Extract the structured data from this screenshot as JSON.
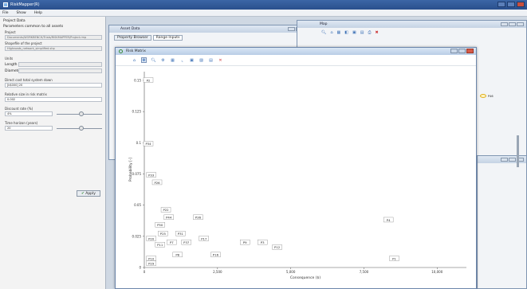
{
  "app": {
    "title": "RiskMapper(R)"
  },
  "menu": [
    "File",
    "Show",
    "Help"
  ],
  "left": {
    "section_title": "Project Data",
    "subsection": "Parameters common to all assets",
    "project_label": "Project",
    "project_value": "Documents/WORKBENCH/Trials/RISKMAPPER/Project.rmp",
    "shapefile_label": "Shapefile of the project",
    "shapefile_value": "Highroads_network_simplified.shp",
    "units_label": "Units",
    "length_label": "Length",
    "diameter_label": "Diameter",
    "direct_cost_label": "Direct cost total system down",
    "direct_cost_value": "[k$000] 20",
    "relative_size_label": "Relative size in risk matrix",
    "relative_size_value": "0.002",
    "discount_label": "Discount rate (%)",
    "discount_value": "4%",
    "discount_level": 0.55,
    "time_label": "Time horizon (years)",
    "time_value": "20",
    "time_level": 0.55,
    "apply_label": "Apply"
  },
  "asset_window": {
    "title": "Asset Data",
    "tabs": [
      "Property Browser",
      "Range Inputs"
    ]
  },
  "map_window": {
    "title": "Map",
    "marker_label": "P46"
  },
  "risk_window": {
    "title": "Risk Matrix"
  },
  "chart_data": {
    "type": "scatter",
    "title": "",
    "xlabel": "Consequence ($)",
    "ylabel": "Probability [-]",
    "xlim": [
      0,
      11000
    ],
    "ylim": [
      0,
      0.157
    ],
    "x_ticks": [
      "0",
      "2,500",
      "5,000",
      "7,500",
      "10,000",
      "12,500"
    ],
    "x_tick_values": [
      0,
      2500,
      5000,
      7500,
      10000,
      12500
    ],
    "y_ticks": [
      "0",
      "0.025",
      "0.05",
      "0.075",
      "0.1",
      "0.125",
      "0.15"
    ],
    "y_tick_values": [
      0,
      0.025,
      0.05,
      0.075,
      0.1,
      0.125,
      0.15
    ],
    "points": [
      {
        "label": "P2",
        "x": 0,
        "y": 0.15
      },
      {
        "label": "P34",
        "x": 0,
        "y": 0.099
      },
      {
        "label": "P33",
        "x": 100,
        "y": 0.074
      },
      {
        "label": "P26",
        "x": 300,
        "y": 0.068
      },
      {
        "label": "P22",
        "x": 600,
        "y": 0.046
      },
      {
        "label": "P44",
        "x": 700,
        "y": 0.04
      },
      {
        "label": "P36",
        "x": 1700,
        "y": 0.04
      },
      {
        "label": "P50",
        "x": 400,
        "y": 0.034
      },
      {
        "label": "P25",
        "x": 500,
        "y": 0.027
      },
      {
        "label": "P31",
        "x": 1100,
        "y": 0.027
      },
      {
        "label": "P17",
        "x": 1900,
        "y": 0.023
      },
      {
        "label": "P9",
        "x": 3300,
        "y": 0.02
      },
      {
        "label": "P3",
        "x": 3900,
        "y": 0.02
      },
      {
        "label": "P20",
        "x": 100,
        "y": 0.023
      },
      {
        "label": "P11",
        "x": 400,
        "y": 0.018
      },
      {
        "label": "P7",
        "x": 800,
        "y": 0.02
      },
      {
        "label": "P37",
        "x": 1300,
        "y": 0.02
      },
      {
        "label": "P8",
        "x": 1000,
        "y": 0.01
      },
      {
        "label": "P16",
        "x": 2300,
        "y": 0.01
      },
      {
        "label": "P10",
        "x": 100,
        "y": 0.007
      },
      {
        "label": "P29",
        "x": 100,
        "y": 0.003
      },
      {
        "label": "P12",
        "x": 4400,
        "y": 0.016
      },
      {
        "label": "P1",
        "x": 8400,
        "y": 0.007
      },
      {
        "label": "P4",
        "x": 8200,
        "y": 0.038
      }
    ]
  }
}
